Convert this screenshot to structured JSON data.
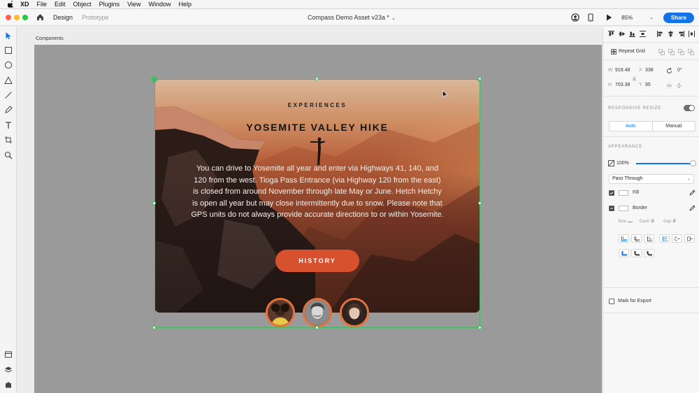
{
  "menubar": {
    "app": "XD",
    "items": [
      "File",
      "Edit",
      "Object",
      "Plugins",
      "View",
      "Window",
      "Help"
    ]
  },
  "titlebar": {
    "tabs": [
      "Design",
      "Prototype"
    ],
    "active_tab": "Design",
    "document_title": "Compass Demo Asset v23a *",
    "zoom": "85%",
    "share_label": "Share"
  },
  "canvas": {
    "artboard_label": "Components"
  },
  "card": {
    "eyebrow": "EXPERIENCES",
    "title": "YOSEMITE VALLEY HIKE",
    "body": "You can drive to Yosemite all year and enter via Highways 41, 140, and 120 from the west. Tioga Pass Entrance (via Highway 120 from the east) is closed from around November through late May or June. Hetch Hetchy is open all year but may close intermittently due to snow. Please note that GPS units do not always provide accurate directions to or within Yosemite.",
    "button_label": "HISTORY"
  },
  "panel": {
    "repeat_grid": "Repeat Grid",
    "w_label": "W",
    "w_value": "919.48",
    "x_label": "X",
    "x_value": "338",
    "h_label": "H",
    "h_value": "703.38",
    "y_label": "Y",
    "y_value": "95",
    "rotation": "0°",
    "responsive_resize": "RESPONSIVE RESIZE",
    "responsive_resize_on": true,
    "resize_modes": [
      "Auto",
      "Manual"
    ],
    "appearance": "APPEARANCE",
    "opacity": "100%",
    "blend_mode": "Pass Through",
    "fill_label": "Fill",
    "fill_checked": true,
    "border_label": "Border",
    "size_label": "Size",
    "dash_label": "Dash",
    "dash_value": "0",
    "gap_label": "Gap",
    "gap_value": "0",
    "mark_for_export": "Mark for Export"
  },
  "colors": {
    "accent": "#1473e6",
    "selection": "#3dbe5a",
    "button": "#d8512e",
    "avatar_ring": "#e8723b"
  }
}
